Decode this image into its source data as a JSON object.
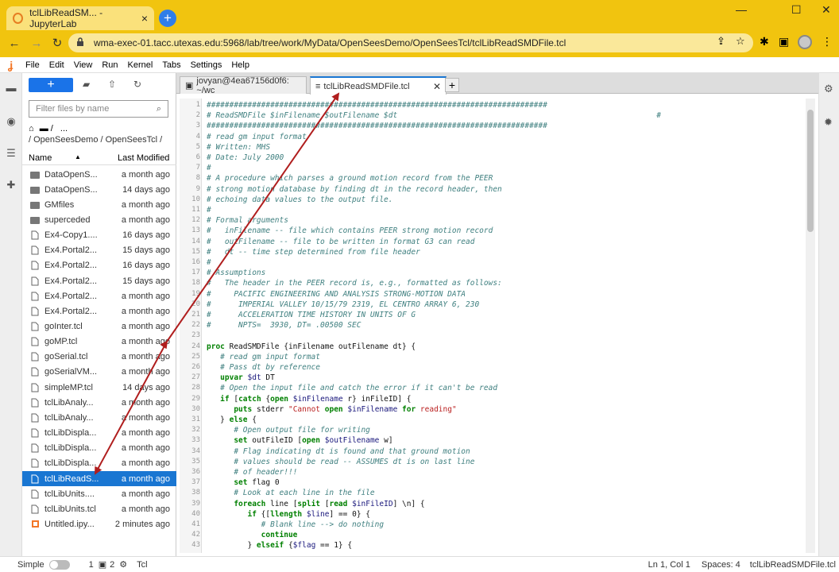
{
  "browser": {
    "tab_title": "tclLibReadSM... - JupyterLab",
    "url": "wma-exec-01.tacc.utexas.edu:5968/lab/tree/work/MyData/OpenSeesDemo/OpenSeesTcl/tclLibReadSMDFile.tcl",
    "new_tab": "+",
    "close": "×",
    "back": "←",
    "forward": "→",
    "reload": "C",
    "minimize": "—",
    "maximize": "☐",
    "close_window": "✕"
  },
  "menu": [
    "File",
    "Edit",
    "View",
    "Run",
    "Kernel",
    "Tabs",
    "Settings",
    "Help"
  ],
  "filebrowser": {
    "new_button": "+",
    "filter_placeholder": "Filter files by name",
    "crumb_root": "/",
    "crumb_more": "...",
    "crumb_path": "/ OpenSeesDemo / OpenSeesTcl /",
    "col_name": "Name",
    "col_modified": "Last Modified",
    "sort_indicator": "▲",
    "files": [
      {
        "name": "DataOpenS...",
        "date": "a month ago",
        "type": "folder"
      },
      {
        "name": "DataOpenS...",
        "date": "14 days ago",
        "type": "folder"
      },
      {
        "name": "GMfiles",
        "date": "a month ago",
        "type": "folder"
      },
      {
        "name": "superceded",
        "date": "a month ago",
        "type": "folder"
      },
      {
        "name": "Ex4-Copy1....",
        "date": "16 days ago",
        "type": "file"
      },
      {
        "name": "Ex4.Portal2...",
        "date": "15 days ago",
        "type": "file"
      },
      {
        "name": "Ex4.Portal2...",
        "date": "16 days ago",
        "type": "file"
      },
      {
        "name": "Ex4.Portal2...",
        "date": "15 days ago",
        "type": "file"
      },
      {
        "name": "Ex4.Portal2...",
        "date": "a month ago",
        "type": "file"
      },
      {
        "name": "Ex4.Portal2...",
        "date": "a month ago",
        "type": "file"
      },
      {
        "name": "goInter.tcl",
        "date": "a month ago",
        "type": "file"
      },
      {
        "name": "goMP.tcl",
        "date": "a month ago",
        "type": "file"
      },
      {
        "name": "goSerial.tcl",
        "date": "a month ago",
        "type": "file"
      },
      {
        "name": "goSerialVM...",
        "date": "a month ago",
        "type": "file"
      },
      {
        "name": "simpleMP.tcl",
        "date": "14 days ago",
        "type": "file"
      },
      {
        "name": "tclLibAnaly...",
        "date": "a month ago",
        "type": "file"
      },
      {
        "name": "tclLibAnaly...",
        "date": "a month ago",
        "type": "file"
      },
      {
        "name": "tclLibDispla...",
        "date": "a month ago",
        "type": "file"
      },
      {
        "name": "tclLibDispla...",
        "date": "a month ago",
        "type": "file"
      },
      {
        "name": "tclLibDispla...",
        "date": "a month ago",
        "type": "file"
      },
      {
        "name": "tclLibReadS...",
        "date": "a month ago",
        "type": "file",
        "selected": true
      },
      {
        "name": "tclLibUnits....",
        "date": "a month ago",
        "type": "file"
      },
      {
        "name": "tclLibUnits.tcl",
        "date": "a month ago",
        "type": "file"
      },
      {
        "name": "Untitled.ipy...",
        "date": "2 minutes ago",
        "type": "notebook"
      }
    ]
  },
  "tabs": {
    "terminal": "jovyan@4ea67156d0f6: ~/wc",
    "editor": "tclLibReadSMDFile.tcl",
    "add": "+"
  },
  "code": [
    "###########################################################################",
    "# ReadSMDFile $inFilename $outFilename $dt                                                         #",
    "###########################################################################",
    "# read gm input format",
    "# Written: MHS",
    "# Date: July 2000",
    "#",
    "# A procedure which parses a ground motion record from the PEER",
    "# strong motion database by finding dt in the record header, then",
    "# echoing data values to the output file.",
    "#",
    "# Formal arguments",
    "#   inFilename -- file which contains PEER strong motion record",
    "#   outFilename -- file to be written in format G3 can read",
    "#   dt -- time step determined from file header",
    "#",
    "# Assumptions",
    "#   The header in the PEER record is, e.g., formatted as follows:",
    "#     PACIFIC ENGINEERING AND ANALYSIS STRONG-MOTION DATA",
    "#      IMPERIAL VALLEY 10/15/79 2319, EL CENTRO ARRAY 6, 230",
    "#      ACCELERATION TIME HISTORY IN UNITS OF G",
    "#      NPTS=  3930, DT= .00500 SEC",
    "",
    "proc ReadSMDFile {inFilename outFilename dt} {",
    "   # read gm input format",
    "   # Pass dt by reference",
    "   upvar $dt DT",
    "   # Open the input file and catch the error if it can't be read",
    "   if [catch {open $inFilename r} inFileID] {",
    "      puts stderr \"Cannot open $inFilename for reading\"",
    "   } else {",
    "      # Open output file for writing",
    "      set outFileID [open $outFilename w]",
    "      # Flag indicating dt is found and that ground motion",
    "      # values should be read -- ASSUMES dt is on last line",
    "      # of header!!!",
    "      set flag 0",
    "      # Look at each line in the file",
    "      foreach line [split [read $inFileID] \\n] {",
    "         if {[llength $line] == 0} {",
    "            # Blank line --> do nothing",
    "            continue",
    "         } elseif {$flag == 1} {"
  ],
  "status": {
    "mode": "Simple",
    "count1": "1",
    "count2": "2",
    "lang": "Tcl",
    "cursor": "Ln 1, Col 1",
    "spaces": "Spaces: 4",
    "file": "tclLibReadSMDFile.tcl"
  },
  "annotation": {
    "color": "#b01e1e"
  }
}
